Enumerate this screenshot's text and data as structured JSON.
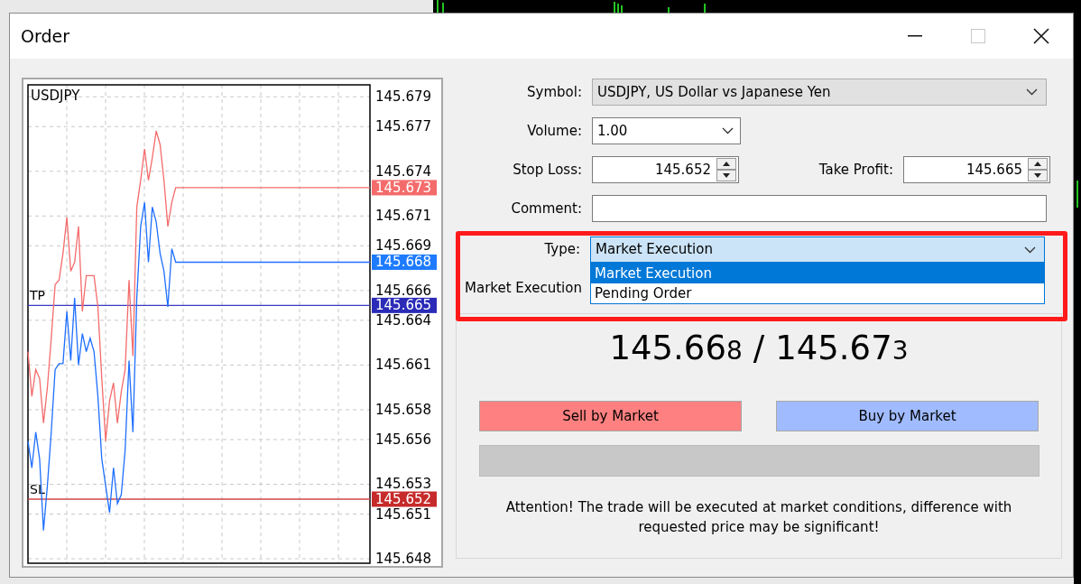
{
  "window": {
    "title": "Order",
    "controls": [
      {
        "kind": "minimize",
        "disabled": false
      },
      {
        "kind": "maximize",
        "disabled": true
      },
      {
        "kind": "close",
        "disabled": false
      }
    ]
  },
  "chart": {
    "chart_data": {
      "type": "line",
      "title": "USDJPY",
      "categories": [
        null,
        null,
        null,
        null,
        null,
        null,
        null,
        null,
        null,
        null,
        null,
        null,
        null,
        null,
        null,
        null,
        null,
        null,
        null,
        null,
        null,
        null,
        null,
        null,
        null,
        null,
        null,
        null,
        null,
        null,
        null,
        null,
        null,
        null,
        null,
        null,
        null,
        null,
        null,
        null,
        null,
        null,
        null,
        null,
        null,
        null,
        null,
        null,
        null,
        null,
        null,
        null,
        null,
        null,
        null,
        null,
        null,
        null,
        null,
        null,
        null,
        null,
        null,
        null,
        null,
        null,
        null,
        null,
        null,
        null,
        null,
        null,
        null,
        null,
        null,
        null,
        null,
        null,
        null,
        null,
        null,
        null,
        null,
        null,
        null,
        null,
        null,
        null,
        null
      ],
      "series": [
        {
          "color": "#f46b6b",
          "values": [
            145.6619,
            145.6589,
            145.6607,
            145.6601,
            145.6571,
            145.6595,
            145.6628,
            145.6664,
            145.6667,
            145.6685,
            145.6709,
            145.6673,
            145.6679,
            145.6703,
            145.6646,
            145.667,
            145.667,
            145.667,
            145.6649,
            145.6601,
            145.6559,
            145.6586,
            145.6598,
            145.6571,
            145.6592,
            145.6607,
            145.6667,
            145.6616,
            145.6716,
            145.6734,
            145.6755,
            145.6734,
            145.6749,
            145.6767,
            145.6758,
            145.6734,
            145.6703,
            145.6719,
            145.6729,
            145.6729,
            145.6729,
            145.6729,
            145.6729,
            145.6729,
            145.6729,
            145.6729,
            145.6729,
            145.6729,
            145.6729,
            145.6729,
            145.6729,
            145.6729,
            145.6729,
            145.6729,
            145.6729,
            145.6729,
            145.6729,
            145.6729,
            145.6729,
            145.6729,
            145.6729,
            145.6729,
            145.6729,
            145.6729,
            145.6729,
            145.6729,
            145.6729,
            145.6729,
            145.6729,
            145.6729,
            145.6729,
            145.6729,
            145.6729,
            145.6729,
            145.6729,
            145.6729,
            145.6729,
            145.6729,
            145.6729,
            145.6729,
            145.6729,
            145.6729,
            145.6729,
            145.6729,
            145.6729,
            145.6729,
            145.6729,
            145.6729,
            145.6729
          ]
        },
        {
          "color": "#1e6fff",
          "values": [
            145.6559,
            145.6541,
            145.6565,
            145.6547,
            145.6499,
            145.6529,
            145.6565,
            145.6607,
            145.6611,
            145.6611,
            145.6646,
            145.6613,
            145.6655,
            145.661,
            145.6631,
            145.6619,
            145.6628,
            145.6619,
            145.6589,
            145.6547,
            145.6529,
            145.6511,
            145.6541,
            145.6517,
            145.6523,
            145.6553,
            145.6613,
            145.6565,
            145.6655,
            145.6703,
            145.6719,
            145.6679,
            145.6716,
            145.6706,
            145.6685,
            145.6673,
            145.6649,
            145.6688,
            145.6679,
            145.6679,
            145.6679,
            145.6679,
            145.6679,
            145.6679,
            145.6679,
            145.6679,
            145.6679,
            145.6679,
            145.6679,
            145.6679,
            145.6679,
            145.6679,
            145.6679,
            145.6679,
            145.6679,
            145.6679,
            145.6679,
            145.6679,
            145.6679,
            145.6679,
            145.6679,
            145.6679,
            145.6679,
            145.6679,
            145.6679,
            145.6679,
            145.6679,
            145.6679,
            145.6679,
            145.6679,
            145.6679,
            145.6679,
            145.6679,
            145.6679,
            145.6679,
            145.6679,
            145.6679,
            145.6679,
            145.6679,
            145.6679,
            145.6679,
            145.6679,
            145.6679,
            145.6679,
            145.6679,
            145.6679,
            145.6679,
            145.6679,
            145.6679
          ]
        }
      ],
      "ylim": [
        145.6477,
        145.6798
      ],
      "yticks": [
        145.679,
        145.677,
        145.674,
        145.671,
        145.669,
        145.666,
        145.664,
        145.661,
        145.658,
        145.656,
        145.653,
        145.651,
        145.648
      ],
      "grid": true,
      "ref_lines": [
        {
          "axis": "y",
          "value": 145.665,
          "label": "TP",
          "color": "#3b3bc4"
        },
        {
          "axis": "y",
          "value": 145.652,
          "label": "SL",
          "color": "#d0474a"
        }
      ]
    },
    "price_tags": [
      {
        "kind": "ask",
        "text": "145.673",
        "color": "#f46b6b"
      },
      {
        "kind": "bid",
        "text": "145.668",
        "color": "#1e7bff"
      },
      {
        "kind": "tp",
        "text": "145.665",
        "color": "#2b2bb8"
      },
      {
        "kind": "sl",
        "text": "145.652",
        "color": "#c62a2a"
      }
    ]
  },
  "form": {
    "symbol": {
      "label": "Symbol:",
      "value": "USDJPY, US Dollar vs Japanese Yen"
    },
    "volume": {
      "label": "Volume:",
      "value": "1.00"
    },
    "stop_loss": {
      "label": "Stop Loss:",
      "value": "145.652"
    },
    "take_profit": {
      "label": "Take Profit:",
      "value": "145.665"
    },
    "comment": {
      "label": "Comment:"
    },
    "highlighted": true,
    "type": {
      "label": "Type:",
      "value": "Market Execution",
      "expanded": true,
      "options": [
        {
          "label": "Market Execution",
          "selected": true
        },
        {
          "label": "Pending Order",
          "selected": false
        }
      ]
    }
  },
  "execution": {
    "label": "Market Execution",
    "bid": {
      "main": "145.66",
      "last": "8"
    },
    "separator": "/",
    "ask": {
      "main": "145.67",
      "last": "3"
    },
    "buttons": [
      {
        "kind": "sell",
        "label": "Sell by Market"
      },
      {
        "kind": "buy",
        "label": "Buy by Market"
      }
    ],
    "progress": {
      "level": 0
    },
    "notice": "Attention! The trade will be executed at market conditions, difference with requested price may be significant!"
  }
}
